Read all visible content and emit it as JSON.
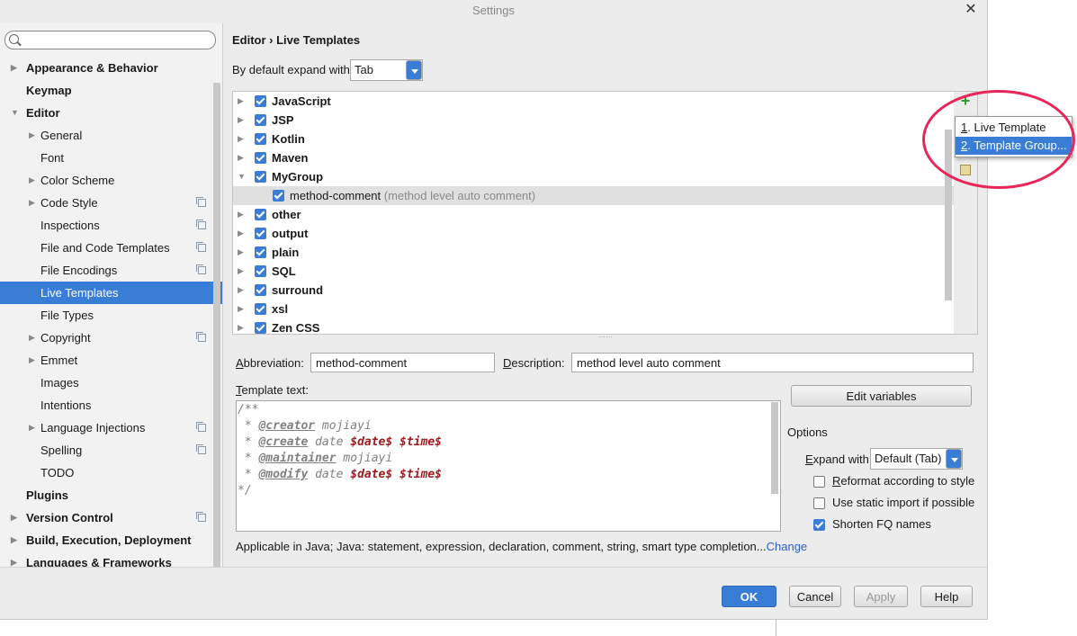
{
  "window": {
    "title": "Settings",
    "close": "✕"
  },
  "sidebar": {
    "search_placeholder": "",
    "items": [
      {
        "label": "Appearance & Behavior",
        "arrow": "▶",
        "bold": true
      },
      {
        "label": "Keymap",
        "arrow": "",
        "bold": true
      },
      {
        "label": "Editor",
        "arrow": "▼",
        "bold": true
      },
      {
        "label": "General",
        "arrow": "▶"
      },
      {
        "label": "Font",
        "arrow": ""
      },
      {
        "label": "Color Scheme",
        "arrow": "▶"
      },
      {
        "label": "Code Style",
        "arrow": "▶",
        "copy": true
      },
      {
        "label": "Inspections",
        "arrow": "",
        "copy": true
      },
      {
        "label": "File and Code Templates",
        "arrow": "",
        "copy": true
      },
      {
        "label": "File Encodings",
        "arrow": "",
        "copy": true
      },
      {
        "label": "Live Templates",
        "arrow": "",
        "selected": true
      },
      {
        "label": "File Types",
        "arrow": ""
      },
      {
        "label": "Copyright",
        "arrow": "▶",
        "copy": true
      },
      {
        "label": "Emmet",
        "arrow": "▶"
      },
      {
        "label": "Images",
        "arrow": ""
      },
      {
        "label": "Intentions",
        "arrow": ""
      },
      {
        "label": "Language Injections",
        "arrow": "▶",
        "copy": true
      },
      {
        "label": "Spelling",
        "arrow": "",
        "copy": true
      },
      {
        "label": "TODO",
        "arrow": ""
      },
      {
        "label": "Plugins",
        "arrow": "",
        "bold": true
      },
      {
        "label": "Version Control",
        "arrow": "▶",
        "bold": true,
        "copy": true
      },
      {
        "label": "Build, Execution, Deployment",
        "arrow": "▶",
        "bold": true
      },
      {
        "label": "Languages & Frameworks",
        "arrow": "▶",
        "bold": true
      }
    ]
  },
  "breadcrumb": "Editor › Live Templates",
  "expand_default": {
    "label": "By default expand with",
    "value": "Tab"
  },
  "template_groups": [
    {
      "label": "JavaScript",
      "arrow": "▶"
    },
    {
      "label": "JSP",
      "arrow": "▶"
    },
    {
      "label": "Kotlin",
      "arrow": "▶"
    },
    {
      "label": "Maven",
      "arrow": "▶"
    },
    {
      "label": "MyGroup",
      "arrow": "▼"
    },
    {
      "label": "method-comment",
      "sub": "(method level auto comment)",
      "child": true
    },
    {
      "label": "other",
      "arrow": "▶"
    },
    {
      "label": "output",
      "arrow": "▶"
    },
    {
      "label": "plain",
      "arrow": "▶"
    },
    {
      "label": "SQL",
      "arrow": "▶"
    },
    {
      "label": "surround",
      "arrow": "▶"
    },
    {
      "label": "xsl",
      "arrow": "▶"
    },
    {
      "label": "Zen CSS",
      "arrow": "▶"
    }
  ],
  "toolbar": {
    "add_icon": "plus-icon",
    "add_symbol": "+",
    "note_icon": "note-icon"
  },
  "popup": {
    "items": [
      {
        "num": "1",
        "label": ". Live Template"
      },
      {
        "num": "2",
        "label": ". Template Group..."
      }
    ]
  },
  "abbreviation": {
    "label_prefix": "A",
    "label_rest": "bbreviation:",
    "value": "method-comment"
  },
  "description": {
    "label_prefix": "D",
    "label_rest": "escription:",
    "value": "method level auto comment"
  },
  "template_text": {
    "label_prefix": "T",
    "label_rest": "emplate text:",
    "lines": [
      [
        {
          "t": "/**",
          "c": ""
        }
      ],
      [
        {
          "t": " * ",
          "c": ""
        },
        {
          "t": "@creator",
          "c": "tag"
        },
        {
          "t": " mojiayi",
          "c": ""
        }
      ],
      [
        {
          "t": " * ",
          "c": ""
        },
        {
          "t": "@create",
          "c": "tag"
        },
        {
          "t": " date ",
          "c": ""
        },
        {
          "t": "$date$",
          "c": "var"
        },
        {
          "t": " ",
          "c": ""
        },
        {
          "t": "$time$",
          "c": "var"
        }
      ],
      [
        {
          "t": " * ",
          "c": ""
        },
        {
          "t": "@maintainer",
          "c": "tag"
        },
        {
          "t": " mojiayi",
          "c": ""
        }
      ],
      [
        {
          "t": " * ",
          "c": ""
        },
        {
          "t": "@modify",
          "c": "tag"
        },
        {
          "t": " date ",
          "c": ""
        },
        {
          "t": "$date$",
          "c": "var"
        },
        {
          "t": " ",
          "c": ""
        },
        {
          "t": "$time$",
          "c": "var"
        }
      ],
      [
        {
          "t": "*/",
          "c": ""
        }
      ]
    ]
  },
  "edit_variables": "Edit variables",
  "options": {
    "title": "Options",
    "expand_label_prefix": "E",
    "expand_label_rest": "xpand with",
    "expand_value": "Default (Tab)",
    "checkboxes": [
      {
        "prefix": "R",
        "rest": "eformat according to style",
        "checked": false
      },
      {
        "prefix": "",
        "rest": "Use static import if possible",
        "checked": false
      },
      {
        "prefix": "",
        "rest": "Shorten FQ names",
        "checked": true
      }
    ]
  },
  "applicable": {
    "text": "Applicable in Java; Java: statement, expression, declaration, comment, string, smart type completion...",
    "link": "Change"
  },
  "buttons": {
    "ok": "OK",
    "cancel": "Cancel",
    "apply": "Apply",
    "help": "Help"
  },
  "colors": {
    "accent": "#3a7dd6",
    "annotation_ring": "#e8265a"
  }
}
